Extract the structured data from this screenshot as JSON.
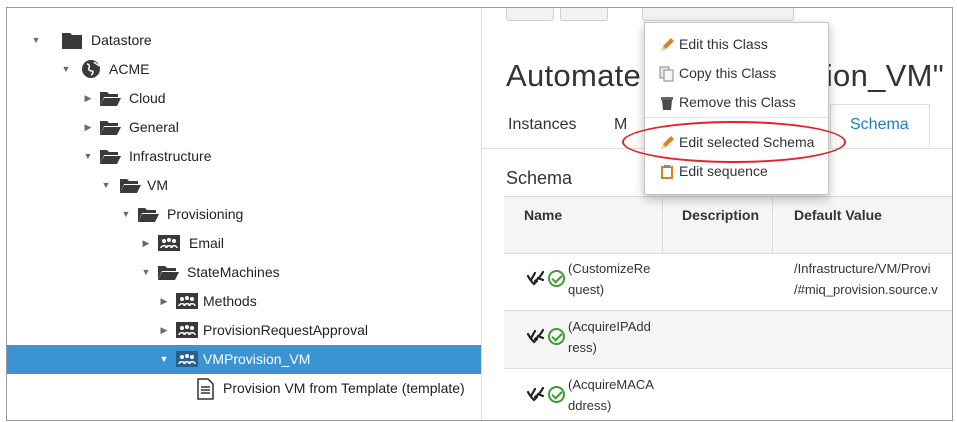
{
  "tree": {
    "items": [
      {
        "label": "Datastore",
        "expanded": true,
        "icon": "folder-solid-icon"
      },
      {
        "label": "ACME",
        "expanded": true,
        "icon": "globe-icon"
      },
      {
        "label": "Cloud",
        "expanded": false,
        "icon": "folder-open-icon"
      },
      {
        "label": "General",
        "expanded": false,
        "icon": "folder-open-icon"
      },
      {
        "label": "Infrastructure",
        "expanded": true,
        "icon": "folder-open-icon"
      },
      {
        "label": "VM",
        "expanded": true,
        "icon": "folder-open-icon"
      },
      {
        "label": "Provisioning",
        "expanded": true,
        "icon": "folder-open-icon"
      },
      {
        "label": "Email",
        "expanded": false,
        "icon": "class-icon"
      },
      {
        "label": "StateMachines",
        "expanded": true,
        "icon": "folder-open-icon"
      },
      {
        "label": "Methods",
        "expanded": false,
        "icon": "class-icon"
      },
      {
        "label": "ProvisionRequestApproval",
        "expanded": false,
        "icon": "class-icon"
      },
      {
        "label": "VMProvision_VM",
        "expanded": true,
        "icon": "class-icon",
        "selected": true
      },
      {
        "label": "Provision VM from Template (template)",
        "icon": "document-icon"
      }
    ]
  },
  "main": {
    "title": "Automate Class Provision_VM\"",
    "tabs": [
      {
        "label": "Instances"
      },
      {
        "label": "M"
      },
      {
        "label": "Schema",
        "active": true
      }
    ],
    "section_title": "Schema",
    "table": {
      "headers": [
        "Name",
        "Description",
        "Default Value"
      ],
      "rows": [
        {
          "name_line1": "(CustomizeRe",
          "name_line2": "quest)",
          "default_line1": "/Infrastructure/VM/Provi",
          "default_line2": "/#miq_provision.source.v"
        },
        {
          "name_line1": "(AcquireIPAdd",
          "name_line2": "ress)",
          "default_line1": "",
          "default_line2": ""
        },
        {
          "name_line1": "(AcquireMACA",
          "name_line2": "ddress)",
          "default_line1": "",
          "default_line2": ""
        }
      ]
    }
  },
  "menu": {
    "items": [
      {
        "label": "Edit this Class",
        "icon": "pencil-icon"
      },
      {
        "label": "Copy this Class",
        "icon": "copy-icon"
      },
      {
        "label": "Remove this Class",
        "icon": "trash-icon"
      },
      {
        "label": "Edit selected Schema",
        "icon": "pencil-icon",
        "highlighted": true
      },
      {
        "label": "Edit sequence",
        "icon": "clipboard-icon"
      }
    ]
  },
  "colors": {
    "selection": "#3b93d3",
    "active_tab": "#1d7ec2",
    "check": "#3f9c35",
    "highlight_oval": "#e0242a"
  }
}
